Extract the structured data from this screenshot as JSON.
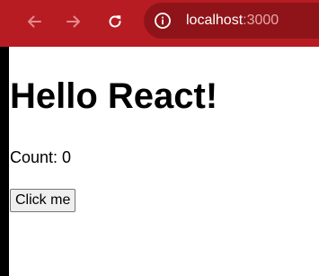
{
  "browser": {
    "url_host": "localhost",
    "url_port": ":3000",
    "icons": {
      "back": "arrow-left-icon",
      "forward": "arrow-right-icon",
      "reload": "reload-icon",
      "site_info": "info-icon"
    },
    "colors": {
      "toolbar": "#b71c22",
      "omnibox": "#8f1419"
    }
  },
  "page": {
    "heading": "Hello React!",
    "count_text": "Count: 0",
    "button_label": "Click me"
  }
}
